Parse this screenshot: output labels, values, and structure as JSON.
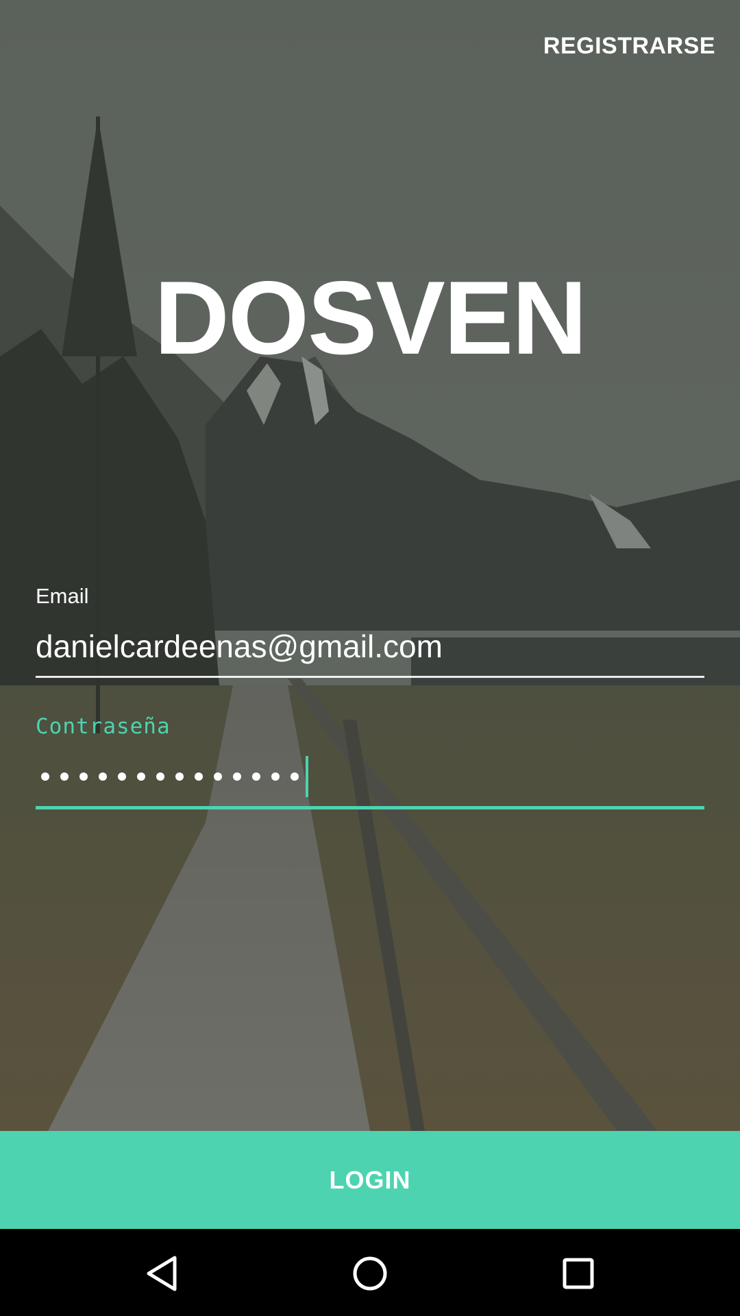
{
  "header": {
    "register_label": "REGISTRARSE"
  },
  "brand": {
    "logo_text": "DOSVEN"
  },
  "form": {
    "email": {
      "label": "Email",
      "value": "danielcardeenas@gmail.com"
    },
    "password": {
      "label": "Contraseña",
      "masked_length": 14
    }
  },
  "actions": {
    "login_label": "LOGIN"
  },
  "navbar": {
    "back_icon": "back-triangle-icon",
    "home_icon": "home-circle-icon",
    "recents_icon": "recents-square-icon"
  },
  "colors": {
    "accent": "#4dd3b0",
    "text": "#ffffff",
    "navbar": "#000000"
  }
}
